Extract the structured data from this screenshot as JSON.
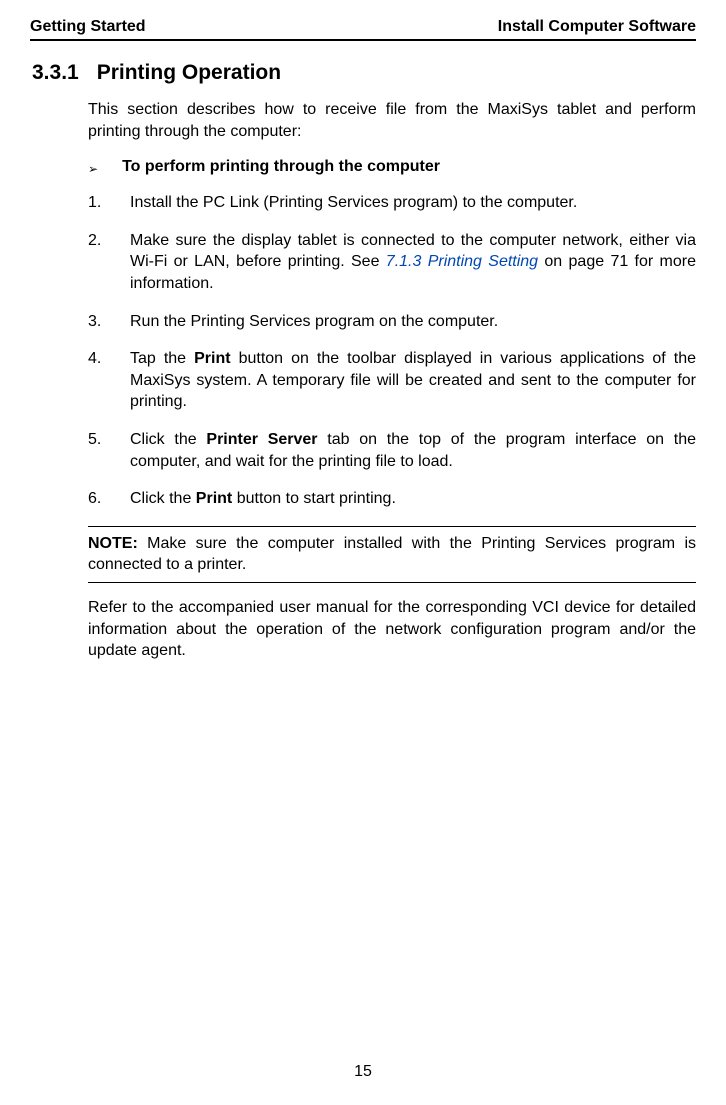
{
  "header": {
    "left": "Getting Started",
    "right": "Install Computer Software"
  },
  "section": {
    "number": "3.3.1",
    "title": "Printing Operation"
  },
  "intro": "This section describes how to receive file from the MaxiSys tablet and perform printing through the computer:",
  "subheading": "To perform printing through the computer",
  "steps": {
    "s1": {
      "num": "1.",
      "text": "Install the PC Link (Printing Services program) to the computer."
    },
    "s2": {
      "num": "2.",
      "pre": "Make sure the display tablet is connected to the computer network, either via Wi-Fi or LAN, before printing. See ",
      "xref": "7.1.3 Printing Setting",
      "post": " on page 71 for more information."
    },
    "s3": {
      "num": "3.",
      "text": "Run the Printing Services program on the computer."
    },
    "s4": {
      "num": "4.",
      "pre": "Tap the ",
      "bold": "Print",
      "post": " button on the toolbar displayed in various applications of the MaxiSys system. A temporary file will be created and sent to the computer for printing."
    },
    "s5": {
      "num": "5.",
      "pre": "Click the ",
      "bold": "Printer Server",
      "post": " tab on the top of the program interface on the computer, and wait for the printing file to load."
    },
    "s6": {
      "num": "6.",
      "pre": "Click the ",
      "bold": "Print",
      "post": " button to start printing."
    }
  },
  "note": {
    "label": "NOTE:",
    "text": " Make sure the computer installed with the Printing Services program is connected to a printer."
  },
  "closing": "Refer to the accompanied user manual for the corresponding VCI device for detailed information about the operation of the network configuration program and/or the update agent.",
  "page_number": "15"
}
